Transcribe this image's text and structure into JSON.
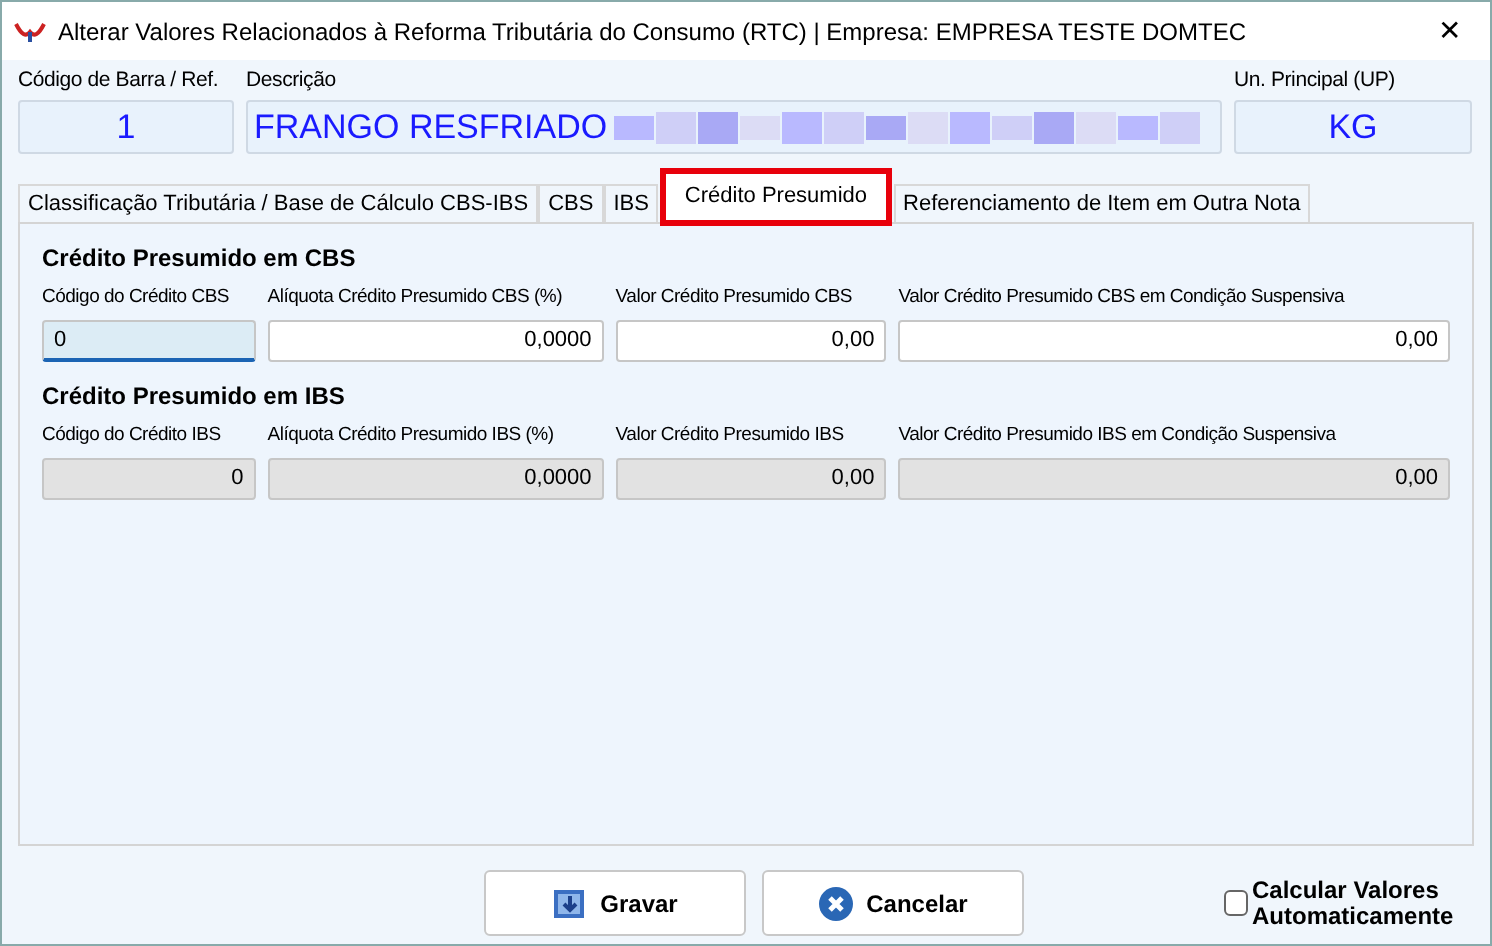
{
  "window": {
    "title": "Alterar Valores Relacionados à Reforma Tributária do Consumo (RTC) | Empresa: EMPRESA TESTE DOMTEC",
    "close": "✕"
  },
  "header_fields": [
    {
      "label": "Código de Barra / Ref.",
      "value": "1"
    },
    {
      "label": "Descrição",
      "value": "FRANGO RESFRIADO",
      "blurred": true
    },
    {
      "label": "Un. Principal (UP)",
      "value": "KG"
    }
  ],
  "tabs": [
    {
      "label": "Classificação Tributária / Base de Cálculo CBS-IBS",
      "selected": false
    },
    {
      "label": "CBS",
      "selected": false
    },
    {
      "label": "IBS",
      "selected": false
    },
    {
      "label": "Crédito Presumido",
      "selected": true
    },
    {
      "label": "Referenciamento de Item em Outra Nota",
      "selected": false
    }
  ],
  "sections": [
    {
      "title": "Crédito Presumido em CBS",
      "fields": [
        {
          "label": "Código do Crédito CBS",
          "value": "0",
          "disabled": false,
          "focused": true
        },
        {
          "label": "Alíquota Crédito Presumido CBS (%)",
          "value": "0,0000",
          "disabled": false,
          "focused": false
        },
        {
          "label": "Valor Crédito Presumido CBS",
          "value": "0,00",
          "disabled": false,
          "focused": false
        },
        {
          "label": "Valor Crédito Presumido CBS em Condição Suspensiva",
          "value": "0,00",
          "disabled": false,
          "focused": false
        }
      ]
    },
    {
      "title": "Crédito Presumido em IBS",
      "fields": [
        {
          "label": "Código do Crédito IBS",
          "value": "0",
          "disabled": true,
          "focused": false
        },
        {
          "label": "Alíquota Crédito Presumido IBS (%)",
          "value": "0,0000",
          "disabled": true,
          "focused": false
        },
        {
          "label": "Valor Crédito Presumido IBS",
          "value": "0,00",
          "disabled": true,
          "focused": false
        },
        {
          "label": "Valor Crédito Presumido IBS em Condição Suspensiva",
          "value": "0,00",
          "disabled": true,
          "focused": false
        }
      ]
    }
  ],
  "buttons": [
    {
      "label": "Gravar",
      "kind": "save"
    },
    {
      "label": "Cancelar",
      "kind": "cancel"
    }
  ],
  "auto_calc": {
    "label": "Calcular Valores Automaticamente",
    "checked": false
  }
}
